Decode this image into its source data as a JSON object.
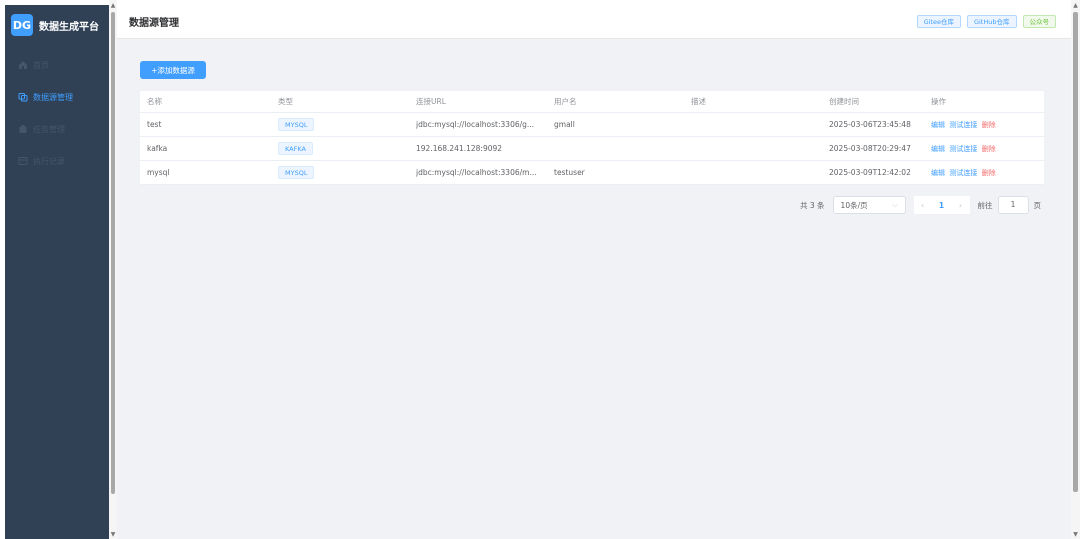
{
  "sidebar": {
    "logo_mark": "DG",
    "logo_title": "数据生成平台",
    "items": [
      {
        "label": "首页",
        "icon": "home-icon",
        "active": false
      },
      {
        "label": "数据源管理",
        "icon": "datasource-icon",
        "active": true
      },
      {
        "label": "任务管理",
        "icon": "task-icon",
        "active": false
      },
      {
        "label": "执行记录",
        "icon": "record-icon",
        "active": false
      }
    ]
  },
  "header": {
    "title": "数据源管理",
    "tags": [
      {
        "label": "Gitee仓库",
        "color": "#409eff"
      },
      {
        "label": "GitHub仓库",
        "color": "#409eff"
      },
      {
        "label": "公众号",
        "color": "#67c23a"
      }
    ]
  },
  "main": {
    "add_button": "+添加数据源",
    "table": {
      "columns": [
        "名称",
        "类型",
        "连接URL",
        "用户名",
        "描述",
        "创建时间",
        "操作"
      ],
      "rows": [
        {
          "name": "test",
          "type": "MYSQL",
          "url": "jdbc:mysql://localhost:3306/g...",
          "user": "gmall",
          "desc": "",
          "created": "2025-03-06T23:45:48"
        },
        {
          "name": "kafka",
          "type": "KAFKA",
          "url": "192.168.241.128:9092",
          "user": "",
          "desc": "",
          "created": "2025-03-08T20:29:47"
        },
        {
          "name": "mysql",
          "type": "MYSQL",
          "url": "jdbc:mysql://localhost:3306/m...",
          "user": "testuser",
          "desc": "",
          "created": "2025-03-09T12:42:02"
        }
      ],
      "ops": {
        "edit": "编辑",
        "test": "测试连接",
        "delete": "删除"
      }
    },
    "pagination": {
      "total": "共 3 条",
      "page_size": "10条/页",
      "prev": "‹",
      "current": "1",
      "next": "›",
      "goto_label": "前往",
      "goto_value": "1",
      "page_suffix": "页"
    }
  },
  "colors": {
    "primary": "#409eff",
    "sidebar_bg": "#304156",
    "danger": "#f56c6c",
    "success": "#67c23a"
  }
}
